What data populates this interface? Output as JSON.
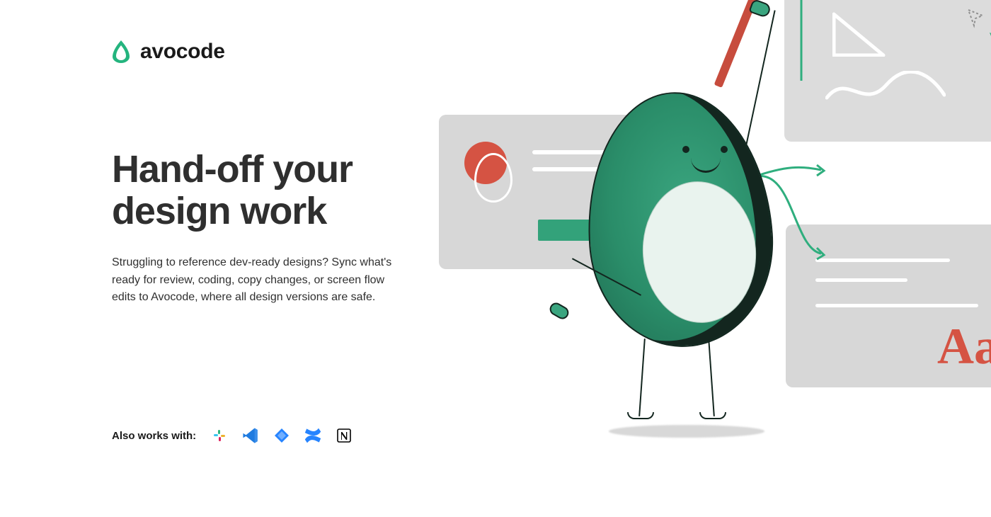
{
  "brand": {
    "name": "avocode",
    "accent_color": "#24b47e"
  },
  "hero": {
    "headline": "Hand-off your design work",
    "subtext": "Struggling to reference dev-ready designs? Sync what's ready for review, coding, copy changes, or screen flow edits to Avocode, where all design versions are safe."
  },
  "works_with": {
    "label": "Also works with:",
    "items": [
      {
        "name": "Slack"
      },
      {
        "name": "Visual Studio Code"
      },
      {
        "name": "Jira"
      },
      {
        "name": "Confluence"
      },
      {
        "name": "Notion"
      }
    ]
  },
  "illustration": {
    "typography_sample": "Aa",
    "accent_red": "#d55343",
    "accent_green": "#33a27a"
  }
}
